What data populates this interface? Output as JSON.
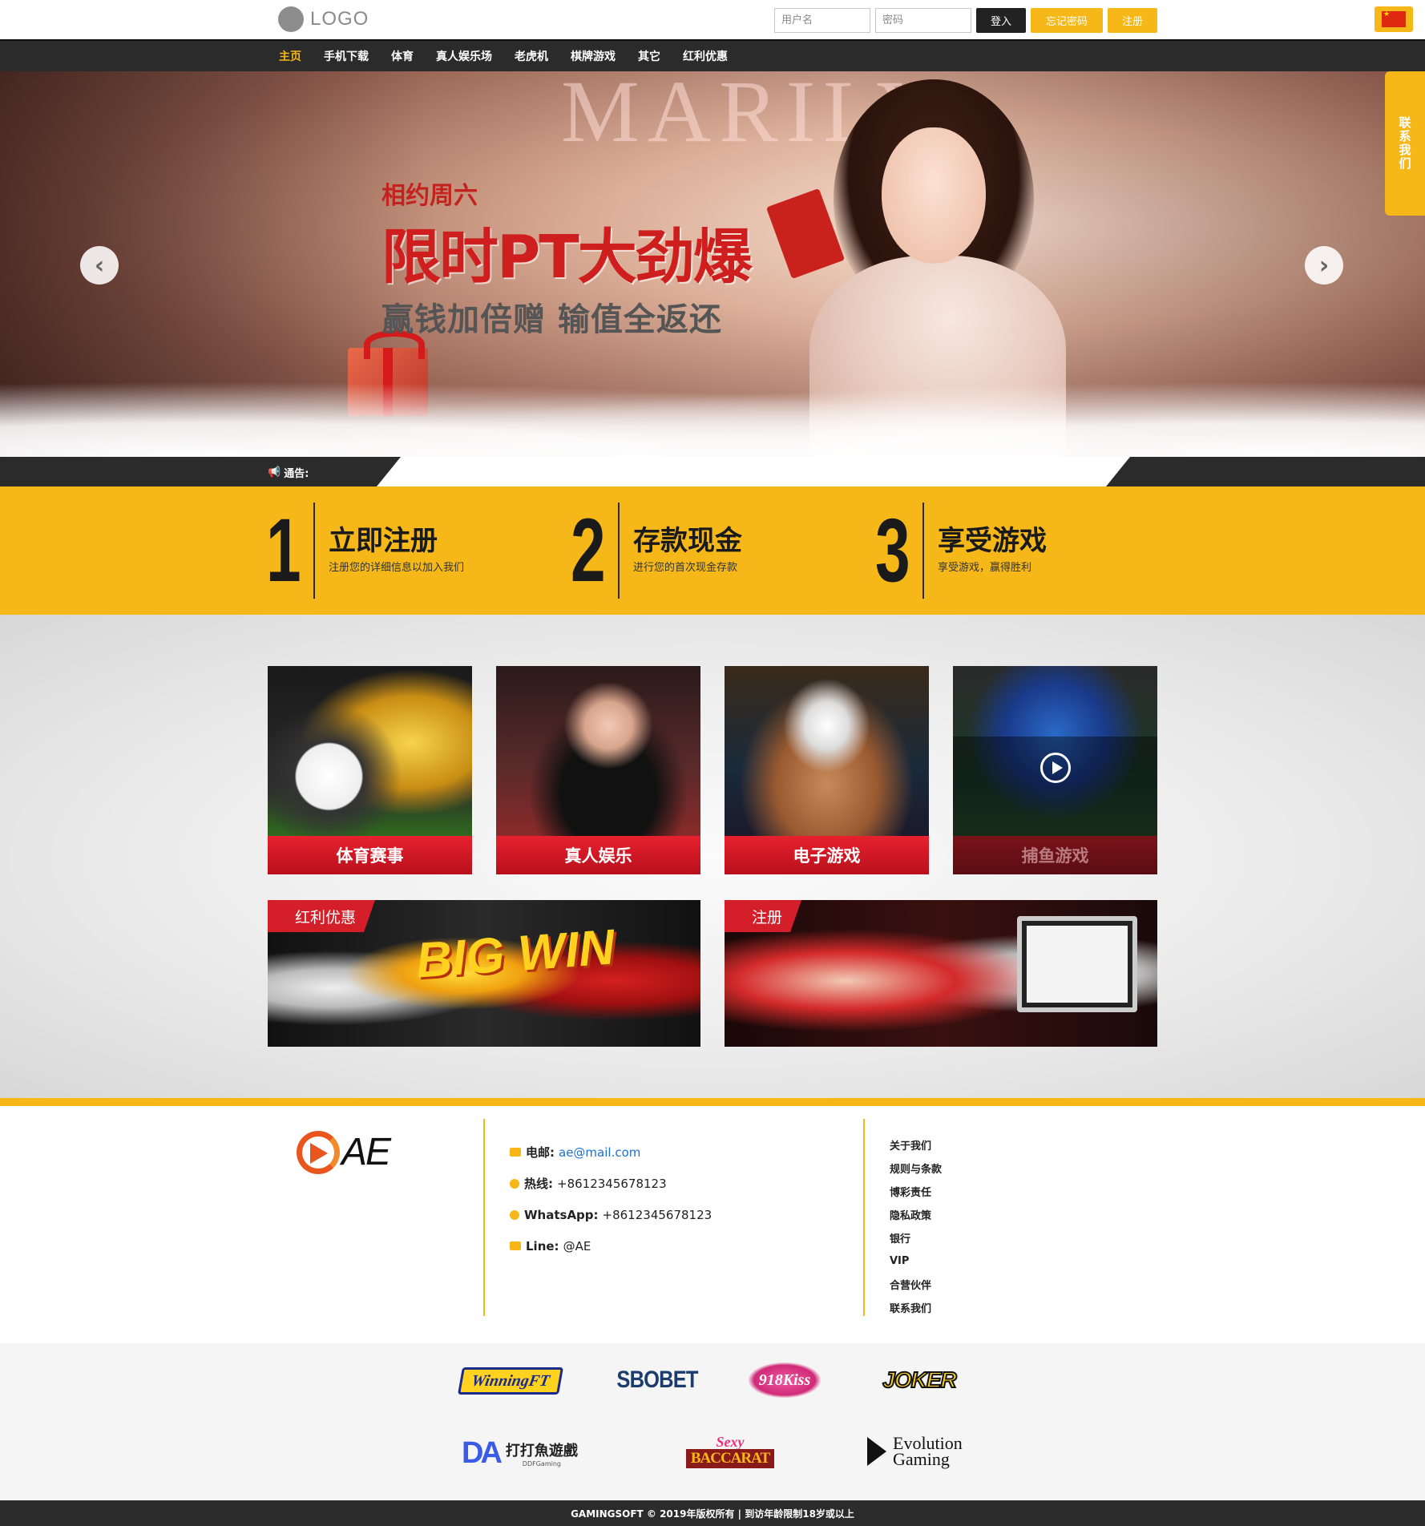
{
  "header": {
    "logo_text": "LOGO",
    "username_placeholder": "用户名",
    "password_placeholder": "密码",
    "login_label": "登入",
    "forgot_label": "忘记密码",
    "register_label": "注册",
    "accent_color": "#f5b818"
  },
  "nav": {
    "items": [
      {
        "label": "主页",
        "active": true
      },
      {
        "label": "手机下载"
      },
      {
        "label": "体育"
      },
      {
        "label": "真人娱乐场"
      },
      {
        "label": "老虎机"
      },
      {
        "label": "棋牌游戏"
      },
      {
        "label": "其它"
      },
      {
        "label": "红利优惠"
      }
    ]
  },
  "banner": {
    "sub": "相约周六",
    "title": "限时PT大劲爆",
    "line": "赢钱加倍赠 输值全返还",
    "sign_text": "MARILYN"
  },
  "contact_tab": "联系我们",
  "notice": {
    "label": "通告:"
  },
  "steps": [
    {
      "num": "1",
      "title": "立即注册",
      "desc": "注册您的详细信息以加入我们"
    },
    {
      "num": "2",
      "title": "存款现金",
      "desc": "进行您的首次现金存款"
    },
    {
      "num": "3",
      "title": "享受游戏",
      "desc": "享受游戏，赢得胜利"
    }
  ],
  "games": [
    {
      "label": "体育赛事"
    },
    {
      "label": "真人娱乐"
    },
    {
      "label": "电子游戏"
    },
    {
      "label": "捕鱼游戏"
    }
  ],
  "promos": [
    {
      "ribbon": "红利优惠",
      "art_text": "BIG WIN"
    },
    {
      "ribbon": "注册"
    }
  ],
  "footer": {
    "brand": "AE",
    "email_label": "电邮:",
    "email_value": "ae@mail.com",
    "hotline_label": "热线:",
    "hotline_value": "+8612345678123",
    "whatsapp_label": "WhatsApp:",
    "whatsapp_value": "+8612345678123",
    "line_label": "Line:",
    "line_value": "@AE",
    "links": [
      "关于我们",
      "规则与条款",
      "博彩责任",
      "隐私政策",
      "银行",
      "VIP",
      "合营伙伴",
      "联系我们"
    ]
  },
  "partners": {
    "winning": "WinningFT",
    "sbobet": "SBOBET",
    "kiss": "918Kiss",
    "joker": "JOKER",
    "dd_mark": "DA",
    "dd_name": "打打魚遊戲",
    "dd_sub": "DDFGaming",
    "sexy": "Sexy",
    "baccarat": "BACCARAT",
    "evo_line1": "Evolution",
    "evo_line2": "Gaming"
  },
  "copyright": "GAMINGSOFT © 2019年版权所有 | 到访年龄限制18岁或以上"
}
